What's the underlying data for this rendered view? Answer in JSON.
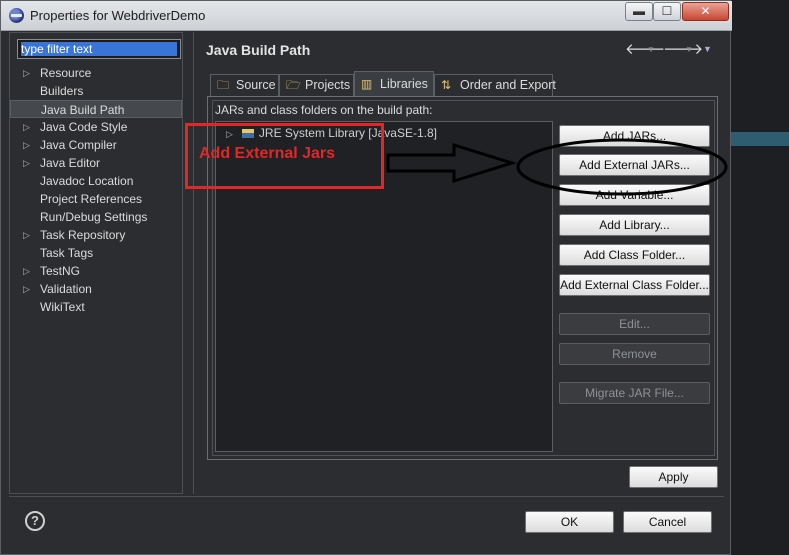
{
  "window": {
    "title": "Properties for WebdriverDemo",
    "minimize_glyph": "▬",
    "maximize_glyph": "☐",
    "close_glyph": "✕"
  },
  "sidebar": {
    "filter_placeholder": "type filter text",
    "items": [
      {
        "label": "Resource",
        "expandable": true
      },
      {
        "label": "Builders",
        "expandable": false
      },
      {
        "label": "Java Build Path",
        "expandable": false,
        "selected": true
      },
      {
        "label": "Java Code Style",
        "expandable": true
      },
      {
        "label": "Java Compiler",
        "expandable": true
      },
      {
        "label": "Java Editor",
        "expandable": true
      },
      {
        "label": "Javadoc Location",
        "expandable": false
      },
      {
        "label": "Project References",
        "expandable": false
      },
      {
        "label": "Run/Debug Settings",
        "expandable": false
      },
      {
        "label": "Task Repository",
        "expandable": true
      },
      {
        "label": "Task Tags",
        "expandable": false
      },
      {
        "label": "TestNG",
        "expandable": true
      },
      {
        "label": "Validation",
        "expandable": true
      },
      {
        "label": "WikiText",
        "expandable": false
      }
    ]
  },
  "content": {
    "title": "Java Build Path",
    "nav": {
      "back_icon": "back-arrow-icon",
      "forward_icon": "forward-arrow-icon",
      "menu_icon": "view-menu-icon"
    }
  },
  "tabs": [
    {
      "label": "Source",
      "icon": "source-folder-icon"
    },
    {
      "label": "Projects",
      "icon": "projects-folder-icon"
    },
    {
      "label": "Libraries",
      "icon": "libraries-icon",
      "active": true
    },
    {
      "label": "Order and Export",
      "icon": "order-export-icon"
    }
  ],
  "libraries": {
    "list_label": "JARs and class folders on the build path:",
    "entries": [
      {
        "label": "JRE System Library [JavaSE-1.8]",
        "icon": "jre-library-icon"
      }
    ],
    "buttons": {
      "add_jars": "Add JARs...",
      "add_external_jars": "Add External JARs...",
      "add_variable": "Add Variable...",
      "add_library": "Add Library...",
      "add_class_folder": "Add Class Folder...",
      "add_external_class_folder": "Add External Class Folder...",
      "edit": "Edit...",
      "remove": "Remove",
      "migrate_jar": "Migrate JAR File..."
    }
  },
  "annotation": {
    "text": "Add External Jars",
    "color": "#e32626"
  },
  "footer": {
    "apply": "Apply",
    "ok": "OK",
    "cancel": "Cancel",
    "help_glyph": "?"
  },
  "colors": {
    "background": "#2b2d30",
    "selection": "#3875d7"
  }
}
